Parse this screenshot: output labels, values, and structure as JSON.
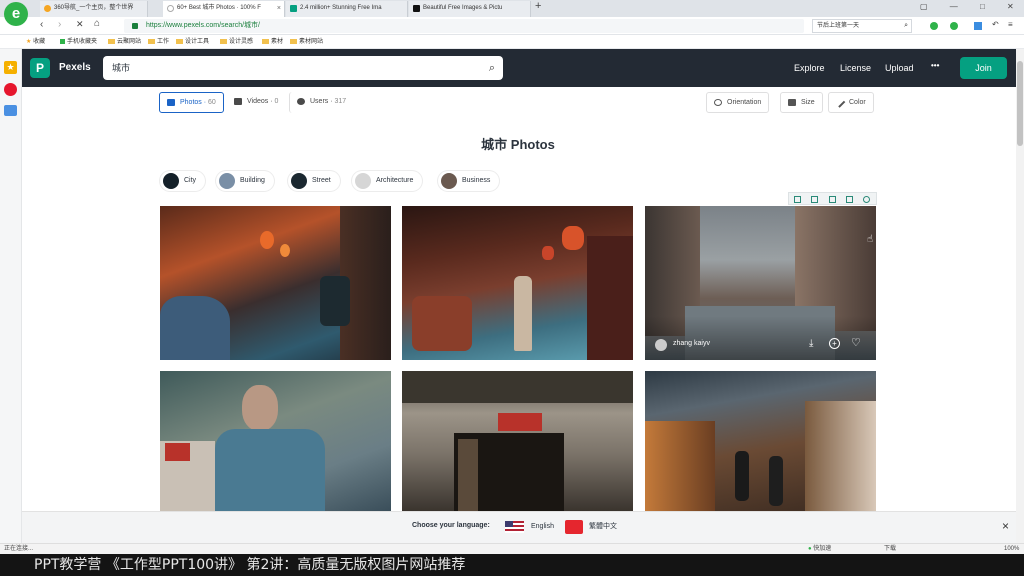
{
  "browser": {
    "tabs": [
      {
        "label": "360导航_一个主页，整个世界",
        "color": "#f5a623"
      },
      {
        "label": "60+ Best 城市 Photos · 100% F",
        "color": "#cccccc"
      },
      {
        "label": "2.4 million+ Stunning Free Ima",
        "color": "#05a081"
      },
      {
        "label": "Beautiful Free Images & Pictu",
        "color": "#111111"
      }
    ],
    "new_tab": "+",
    "url": "https://www.pexels.com/search/城市/",
    "search_engine_text": "节后上班第一天",
    "bookmarks": [
      "收藏",
      "手机收藏夹",
      "云聚网站",
      "工作",
      "设计工具",
      "设计灵感",
      "素材",
      "素材网站"
    ]
  },
  "header": {
    "logo_letter": "P",
    "brand": "Pexels",
    "search_value": "城市",
    "links": [
      "Explore",
      "License",
      "Upload"
    ],
    "more": "•••",
    "join": "Join"
  },
  "filters": {
    "photos_label": "Photos",
    "photos_count": "60",
    "videos_label": "Videos",
    "videos_count": "0",
    "users_label": "Users",
    "users_count": "317",
    "orientation": "Orientation",
    "size": "Size",
    "color": "Color"
  },
  "page_title": "城市 Photos",
  "related": [
    "City",
    "Building",
    "Street",
    "Architecture",
    "Business"
  ],
  "hover_photo": {
    "author": "zhang kaiyv"
  },
  "language_bar": {
    "prompt": "Choose your language:",
    "options": [
      "English",
      "繁體中文"
    ],
    "close": "×"
  },
  "status": {
    "left": "正在连接...",
    "right_items": [
      "快加速",
      "下载",
      "100%"
    ]
  },
  "caption": "PPT教学营  《工作型PPT100讲》 第2讲：高质量无版权图片网站推荐",
  "colors": {
    "brand_green": "#05a081",
    "header_bg": "#232a34",
    "active_blue": "#1a63c6"
  }
}
